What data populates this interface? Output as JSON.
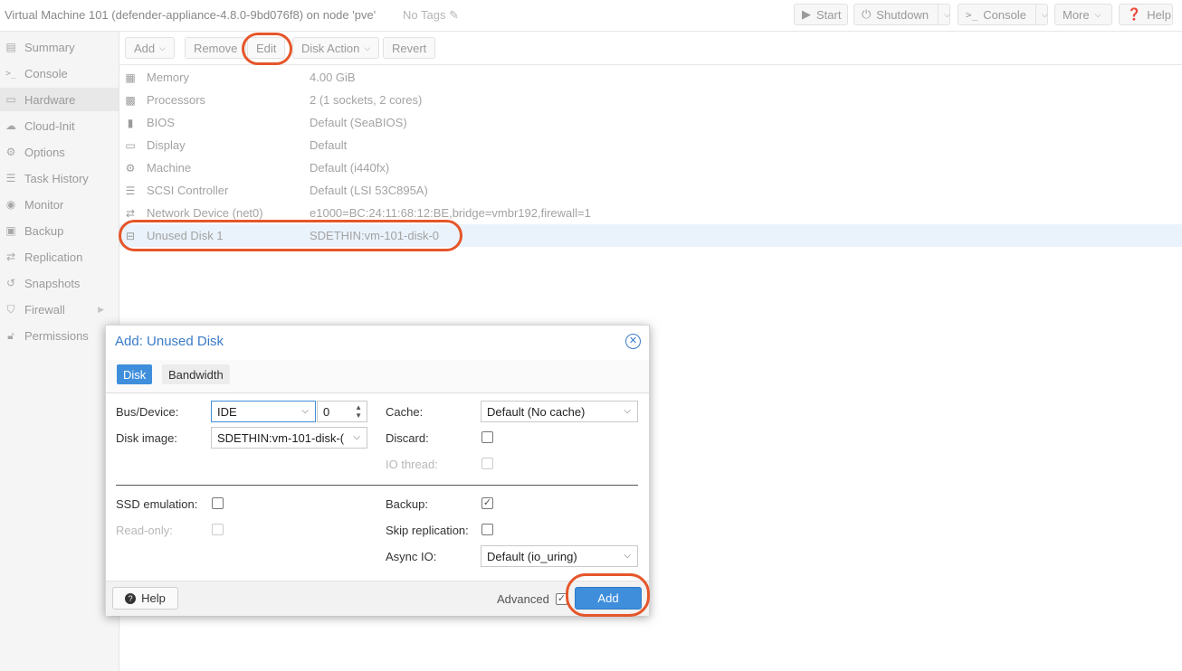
{
  "header": {
    "title": "Virtual Machine 101 (defender-appliance-4.8.0-9bd076f8) on node 'pve'",
    "tags_label": "No Tags",
    "buttons": {
      "start": "Start",
      "shutdown": "Shutdown",
      "console": "Console",
      "more": "More",
      "help": "Help"
    }
  },
  "sidebar": {
    "items": [
      {
        "label": "Summary",
        "icon": "book-icon"
      },
      {
        "label": "Console",
        "icon": "terminal-icon"
      },
      {
        "label": "Hardware",
        "icon": "desktop-icon"
      },
      {
        "label": "Cloud-Init",
        "icon": "cloud-icon"
      },
      {
        "label": "Options",
        "icon": "gear-icon"
      },
      {
        "label": "Task History",
        "icon": "list-icon"
      },
      {
        "label": "Monitor",
        "icon": "eye-icon"
      },
      {
        "label": "Backup",
        "icon": "floppy-icon"
      },
      {
        "label": "Replication",
        "icon": "retweet-icon"
      },
      {
        "label": "Snapshots",
        "icon": "history-icon"
      },
      {
        "label": "Firewall",
        "icon": "shield-icon"
      },
      {
        "label": "Permissions",
        "icon": "unlock-icon"
      }
    ],
    "active": "Hardware"
  },
  "toolbar": {
    "add": "Add",
    "remove": "Remove",
    "edit": "Edit",
    "disk_action": "Disk Action",
    "revert": "Revert"
  },
  "hardware": {
    "rows": [
      {
        "name": "Memory",
        "value": "4.00 GiB",
        "icon": "memory-icon"
      },
      {
        "name": "Processors",
        "value": "2 (1 sockets, 2 cores)",
        "icon": "cpu-icon"
      },
      {
        "name": "BIOS",
        "value": "Default (SeaBIOS)",
        "icon": "microchip-icon"
      },
      {
        "name": "Display",
        "value": "Default",
        "icon": "desktop-icon"
      },
      {
        "name": "Machine",
        "value": "Default (i440fx)",
        "icon": "cogs-icon"
      },
      {
        "name": "SCSI Controller",
        "value": "Default (LSI 53C895A)",
        "icon": "database-icon"
      },
      {
        "name": "Network Device (net0)",
        "value": "e1000=BC:24:11:68:12:BE,bridge=vmbr192,firewall=1",
        "icon": "exchange-icon"
      },
      {
        "name": "Unused Disk 1",
        "value": "SDETHIN:vm-101-disk-0",
        "icon": "hdd-icon"
      }
    ]
  },
  "dialog": {
    "title": "Add: Unused Disk",
    "tabs": [
      "Disk",
      "Bandwidth"
    ],
    "active_tab": "Disk",
    "fields": {
      "bus_device_label": "Bus/Device:",
      "bus_value": "IDE",
      "device_number": "0",
      "disk_image_label": "Disk image:",
      "disk_image_value": "SDETHIN:vm-101-disk-(",
      "cache_label": "Cache:",
      "cache_value": "Default (No cache)",
      "discard_label": "Discard:",
      "io_thread_label": "IO thread:",
      "ssd_label": "SSD emulation:",
      "readonly_label": "Read-only:",
      "backup_label": "Backup:",
      "skip_replication_label": "Skip replication:",
      "async_io_label": "Async IO:",
      "async_io_value": "Default (io_uring)"
    },
    "checkboxes": {
      "discard": false,
      "io_thread": false,
      "ssd_emulation": false,
      "read_only": false,
      "backup": true,
      "skip_replication": false,
      "advanced": true
    },
    "footer": {
      "help": "Help",
      "advanced_label": "Advanced",
      "add": "Add"
    }
  },
  "colors": {
    "accent": "#3f8edc",
    "title_blue": "#3a7bc8",
    "highlight": "#e5562a",
    "selected_row": "#eaf3fb"
  }
}
